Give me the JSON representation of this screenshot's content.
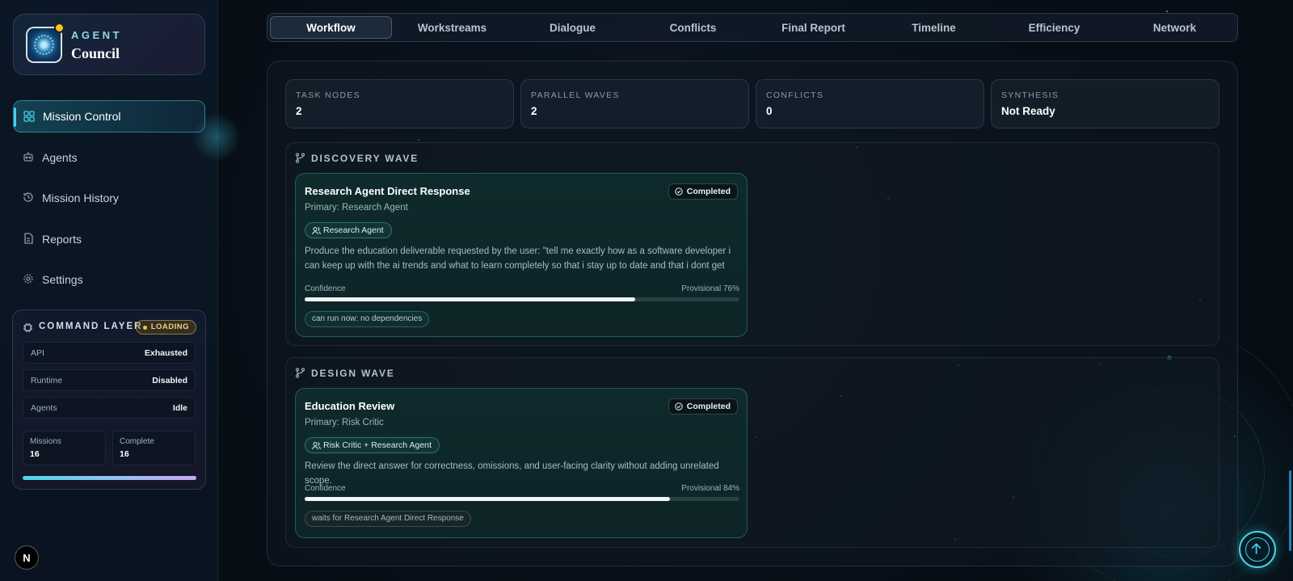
{
  "brand": {
    "line1": "AGENT",
    "line2": "Council"
  },
  "sidebar": {
    "items": [
      {
        "label": "Mission Control",
        "icon": "dashboard-icon",
        "active": true
      },
      {
        "label": "Agents",
        "icon": "bot-icon"
      },
      {
        "label": "Mission History",
        "icon": "history-icon"
      },
      {
        "label": "Reports",
        "icon": "document-icon"
      },
      {
        "label": "Settings",
        "icon": "gear-icon"
      }
    ]
  },
  "command_layer": {
    "title": "COMMAND LAYER",
    "status": "LOADING",
    "rows": [
      {
        "key": "API",
        "value": "Exhausted"
      },
      {
        "key": "Runtime",
        "value": "Disabled"
      },
      {
        "key": "Agents",
        "value": "Idle"
      }
    ],
    "missions": {
      "label": "Missions",
      "value": "16"
    },
    "complete": {
      "label": "Complete",
      "value": "16"
    }
  },
  "bottom_badge": "N",
  "tabs": [
    {
      "label": "Workflow",
      "active": true
    },
    {
      "label": "Workstreams"
    },
    {
      "label": "Dialogue"
    },
    {
      "label": "Conflicts"
    },
    {
      "label": "Final Report"
    },
    {
      "label": "Timeline"
    },
    {
      "label": "Efficiency"
    },
    {
      "label": "Network"
    }
  ],
  "stats": [
    {
      "label": "TASK NODES",
      "value": "2"
    },
    {
      "label": "PARALLEL WAVES",
      "value": "2"
    },
    {
      "label": "CONFLICTS",
      "value": "0"
    },
    {
      "label": "SYNTHESIS",
      "value": "Not Ready"
    }
  ],
  "waves": [
    {
      "title": "DISCOVERY WAVE",
      "card": {
        "title": "Research Agent Direct Response",
        "status": "Completed",
        "primary": "Primary: Research Agent",
        "chip": "Research Agent",
        "description": "Produce the education deliverable requested by the user: \"tell me exactly how as a software developer i can keep up with the ai trends and what to learn completely so that i stay up to date and that i dont get left...",
        "confidence_label": "Confidence",
        "confidence_text": "Provisional 76%",
        "confidence": 0.76,
        "dependency": "can run now: no dependencies"
      }
    },
    {
      "title": "DESIGN WAVE",
      "card": {
        "title": "Education Review",
        "status": "Completed",
        "primary": "Primary: Risk Critic",
        "chip": "Risk Critic + Research Agent",
        "description": "Review the direct answer for correctness, omissions, and user-facing clarity without adding unrelated scope.",
        "confidence_label": "Confidence",
        "confidence_text": "Provisional 84%",
        "confidence": 0.84,
        "dependency": "waits for Research Agent Direct Response"
      }
    }
  ],
  "colors": {
    "accent": "#3fd4e8",
    "loading": "#f2c14e",
    "card_border": "#3cc8b4"
  }
}
